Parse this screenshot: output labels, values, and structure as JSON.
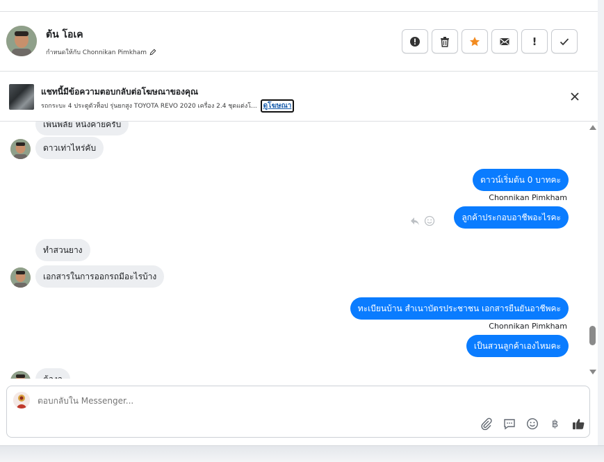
{
  "header": {
    "contact_name": "ต้น โอเค",
    "assigned_to": "กำหนดให้กับ Chonnikan Pimkham",
    "actions": [
      "mark-spam",
      "delete",
      "star",
      "email",
      "important",
      "done"
    ]
  },
  "ad": {
    "title": "แชทนี้มีข้อความตอบกลับต่อโฆษณาของคุณ",
    "description": "รถกระบะ 4 ประตูตัวท็อป รุ่นยกสูง TOYOTA REVO 2020 เครื่อง 2.4 ชุดแต่งโ...",
    "link": "ดูโฆษณา"
  },
  "messages": [
    {
      "dir": "in",
      "text": "เพ้นพลัย หนึ่งคายครับ"
    },
    {
      "dir": "in",
      "text": "ดาวเท่าไหร่คับ"
    },
    {
      "dir": "out",
      "text": "ดาวน์เริ่มต้น 0 บาทคะ"
    },
    {
      "dir": "out",
      "sender": "Chonnikan Pimkham",
      "text": "ลูกค้าประกอบอาชีพอะไรคะ"
    },
    {
      "dir": "in",
      "text": "ทำสวนยาง"
    },
    {
      "dir": "in",
      "text": "เอกสารในการออกรถมีอะไรบ้าง"
    },
    {
      "dir": "out",
      "text": "ทะเบียนบ้าน สำเนาบัตรประชาชน เอกสารยืนยันอาชีพคะ"
    },
    {
      "dir": "out",
      "sender": "Chonnikan Pimkham",
      "text": "เป็นสวนลูกค้าเองไหมคะ"
    },
    {
      "dir": "in",
      "text": "ต้องจ"
    }
  ],
  "composer": {
    "placeholder": "ตอบกลับใน Messenger...",
    "tools": [
      "attachment-icon",
      "saved-reply-icon",
      "emoji-icon",
      "baht-icon",
      "thumbs-up-icon"
    ],
    "baht_symbol": "฿"
  },
  "colors": {
    "accent": "#0a7cff",
    "star": "#f28b20",
    "incoming_bubble": "#eceef1"
  }
}
